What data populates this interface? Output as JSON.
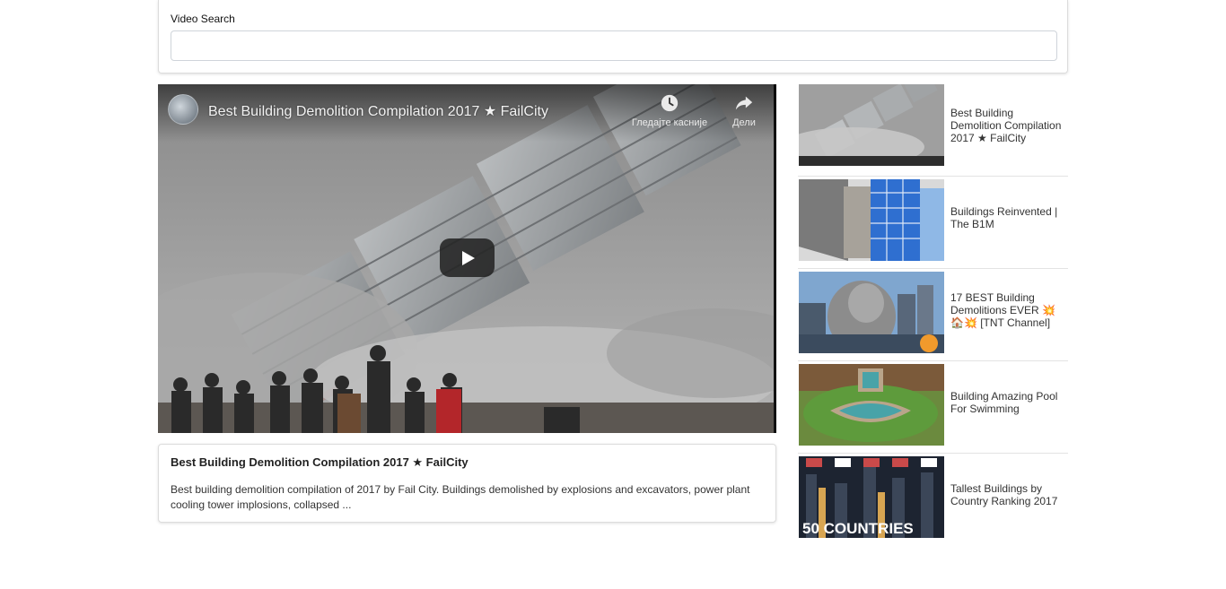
{
  "search": {
    "label": "Video Search",
    "value": "",
    "placeholder": ""
  },
  "player": {
    "title": "Best Building Demolition Compilation 2017 ★ FailCity",
    "watch_later_label": "Гледајте касније",
    "share_label": "Дели",
    "icons": [
      "channel-avatar",
      "clock-icon",
      "share-arrow-icon",
      "play-icon"
    ]
  },
  "selected_video": {
    "title": "Best Building Demolition Compilation 2017 ★ FailCity",
    "description": "Best building demolition compilation of 2017 by Fail City. Buildings demolished by explosions and excavators, power plant cooling tower implosions, collapsed ..."
  },
  "video_list": [
    {
      "title": "Best Building Demolition Compilation 2017 ★ FailCity"
    },
    {
      "title": "Buildings Reinvented | The B1M"
    },
    {
      "title": "17 BEST Building Demolitions EVER 💥🏠💥 [TNT Channel]"
    },
    {
      "title": "Building Amazing Pool For Swimming"
    },
    {
      "title": "Tallest Buildings by Country Ranking 2017",
      "thumb_text": "50 COUNTRIES"
    }
  ],
  "colors": {
    "card_border": "#dcdcdc",
    "play_button_bg": "#212121",
    "divider": "#e3e3e3"
  }
}
